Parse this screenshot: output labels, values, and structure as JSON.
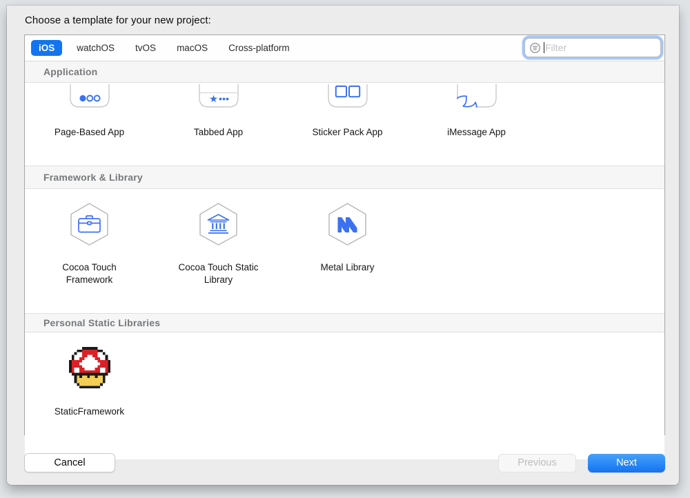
{
  "dialog": {
    "title": "Choose a template for your new project:"
  },
  "platform_tabs": {
    "selected_index": 0,
    "items": [
      {
        "label": "iOS"
      },
      {
        "label": "watchOS"
      },
      {
        "label": "tvOS"
      },
      {
        "label": "macOS"
      },
      {
        "label": "Cross-platform"
      }
    ]
  },
  "filter_field": {
    "placeholder": "Filter",
    "value": "",
    "icon": "filter-icon"
  },
  "sections": {
    "application": {
      "header": "Application",
      "items": [
        {
          "label": "Page-Based App",
          "icon": "page-based-app-icon"
        },
        {
          "label": "Tabbed App",
          "icon": "tabbed-app-icon"
        },
        {
          "label": "Sticker Pack App",
          "icon": "sticker-pack-app-icon"
        },
        {
          "label": "iMessage App",
          "icon": "imessage-app-icon"
        }
      ]
    },
    "framework_library": {
      "header": "Framework & Library",
      "items": [
        {
          "label": "Cocoa Touch Framework",
          "icon": "briefcase-hexagon-icon"
        },
        {
          "label": "Cocoa Touch Static Library",
          "icon": "library-building-hexagon-icon"
        },
        {
          "label": "Metal Library",
          "icon": "metal-hexagon-icon"
        }
      ]
    },
    "personal": {
      "header": "Personal Static Libraries",
      "items": [
        {
          "label": "StaticFramework",
          "icon": "mushroom-icon"
        }
      ]
    }
  },
  "footer": {
    "cancel_label": "Cancel",
    "previous_label": "Previous",
    "next_label": "Next",
    "previous_disabled": true
  },
  "colors": {
    "accent_blue": "#1374f2",
    "icon_blue": "#3c71f2",
    "focus_ring": "rgba(77,144,245,0.5)"
  }
}
